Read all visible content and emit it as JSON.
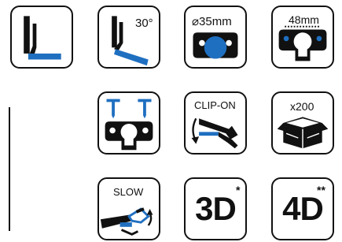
{
  "colors": {
    "blue": "#1f6fc0",
    "black": "#111111"
  },
  "icons": [
    {
      "name": "hinge-flat-icon"
    },
    {
      "name": "hinge-angle-icon",
      "label": "30°"
    },
    {
      "name": "cup-diameter-icon",
      "label": "⌀35mm"
    },
    {
      "name": "screw-distance-icon",
      "label": "48mm"
    },
    {
      "name": "screw-mount-icon"
    },
    {
      "name": "clip-on-icon",
      "label": "CLIP-ON"
    },
    {
      "name": "quantity-box-icon",
      "label": "x200"
    },
    {
      "name": "slow-close-icon",
      "label": "SLOW"
    },
    {
      "name": "3d-adjust-icon",
      "label": "3D",
      "mark": "*"
    },
    {
      "name": "4d-adjust-icon",
      "label": "4D",
      "mark": "**"
    }
  ]
}
